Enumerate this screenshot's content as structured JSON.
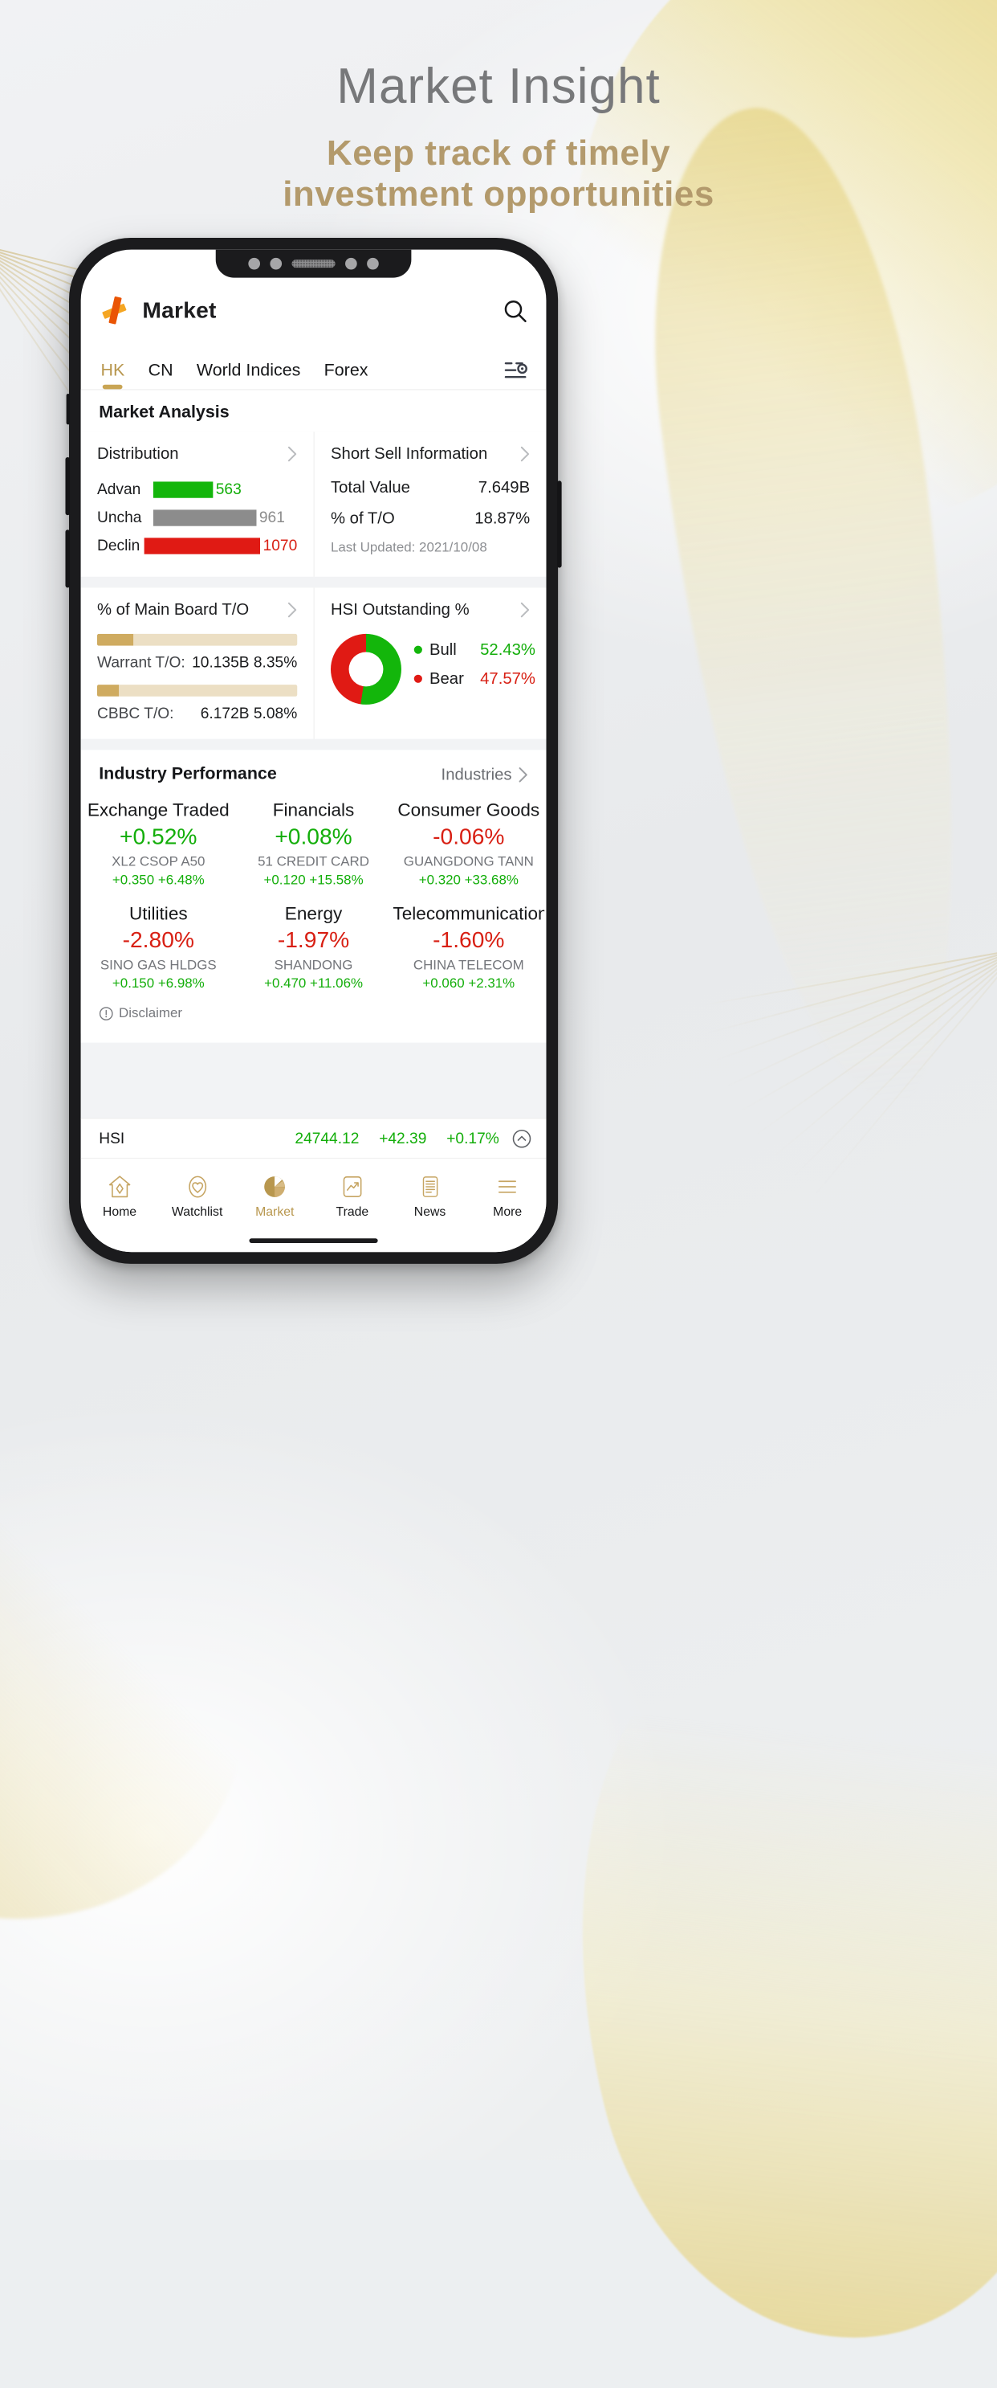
{
  "hero": {
    "title": "Market Insight",
    "subtitle_line1": "Keep track of timely",
    "subtitle_line2": "investment opportunities",
    "title_color": "#77787a",
    "subtitle_color": "#b39a6c"
  },
  "app": {
    "title": "Market",
    "logo_icon": "brand-arrow-logo",
    "search_icon": "search-icon"
  },
  "tabs": {
    "items": [
      {
        "label": "HK",
        "active": true
      },
      {
        "label": "CN",
        "active": false
      },
      {
        "label": "World Indices",
        "active": false
      },
      {
        "label": "Forex",
        "active": false
      }
    ],
    "filter_icon": "settings-sliders-icon",
    "active_color": "#b8974e"
  },
  "market_analysis": {
    "section_title": "Market Analysis",
    "distribution": {
      "title": "Distribution",
      "chevron_icon": "chevron-right-icon",
      "rows": [
        {
          "label": "Advan",
          "value": "563",
          "color": "#13b60b",
          "bar_pct": 33
        },
        {
          "label": "Uncha",
          "value": "961",
          "color": "#8c8c8c",
          "bar_pct": 57
        },
        {
          "label": "Declin",
          "value": "1070",
          "color": "#e01a14",
          "bar_pct": 64
        }
      ]
    },
    "short_sell": {
      "title": "Short Sell Information",
      "chevron_icon": "chevron-right-icon",
      "rows": [
        {
          "label": "Total Value",
          "value": "7.649B"
        },
        {
          "label": "% of T/O",
          "value": "18.87%"
        }
      ],
      "last_updated": "Last Updated: 2021/10/08"
    },
    "main_board": {
      "title": "% of Main Board T/O",
      "chevron_icon": "chevron-right-icon",
      "rows": [
        {
          "label": "Warrant T/O:",
          "value": "10.135B 8.35%",
          "bar_pct": 18
        },
        {
          "label": "CBBC T/O:",
          "value": "6.172B 5.08%",
          "bar_pct": 11
        }
      ]
    },
    "hsi_outstanding": {
      "title": "HSI Outstanding %",
      "chevron_icon": "chevron-right-icon",
      "donut_icon": "donut-chart",
      "legend": [
        {
          "name": "Bull",
          "value": "52.43%",
          "color": "#13b60b"
        },
        {
          "name": "Bear",
          "value": "47.57%",
          "color": "#e01a14"
        }
      ]
    }
  },
  "industry": {
    "section_title": "Industry Performance",
    "more_label": "Industries",
    "more_chevron_icon": "chevron-right-icon",
    "cells": [
      {
        "name": "Exchange Traded",
        "pct": "+0.52%",
        "dir": "up",
        "stock": "XL2 CSOP A50",
        "delta": "+0.350 +6.48%",
        "delta_dir": "up"
      },
      {
        "name": "Financials",
        "pct": "+0.08%",
        "dir": "up",
        "stock": "51 CREDIT CARD",
        "delta": "+0.120 +15.58%",
        "delta_dir": "up"
      },
      {
        "name": "Consumer Goods",
        "pct": "-0.06%",
        "dir": "down",
        "stock": "GUANGDONG TANN",
        "delta": "+0.320 +33.68%",
        "delta_dir": "up"
      },
      {
        "name": "Utilities",
        "pct": "-2.80%",
        "dir": "down",
        "stock": "SINO GAS HLDGS",
        "delta": "+0.150 +6.98%",
        "delta_dir": "up"
      },
      {
        "name": "Energy",
        "pct": "-1.97%",
        "dir": "down",
        "stock": "SHANDONG",
        "delta": "+0.470 +11.06%",
        "delta_dir": "up"
      },
      {
        "name": "Telecommunications",
        "pct": "-1.60%",
        "dir": "down",
        "stock": "CHINA TELECOM",
        "delta": "+0.060 +2.31%",
        "delta_dir": "up"
      }
    ],
    "disclaimer": "Disclaimer",
    "disclaimer_icon": "exclamation-circle-icon"
  },
  "ticker": {
    "symbol": "HSI",
    "price": "24744.12",
    "change": "+42.39",
    "change_pct": "+0.17%",
    "dir": "up",
    "expand_icon": "chevron-up-circle-icon"
  },
  "bottom_nav": {
    "items": [
      {
        "label": "Home",
        "icon": "home-icon",
        "active": false
      },
      {
        "label": "Watchlist",
        "icon": "heart-icon",
        "active": false
      },
      {
        "label": "Market",
        "icon": "pie-chart-icon",
        "active": true
      },
      {
        "label": "Trade",
        "icon": "trend-up-icon",
        "active": false
      },
      {
        "label": "News",
        "icon": "news-icon",
        "active": false
      },
      {
        "label": "More",
        "icon": "menu-icon",
        "active": false
      }
    ],
    "active_color": "#b8974e"
  },
  "colors": {
    "up": "#13ae0a",
    "down": "#d81f13",
    "gold": "#b8974e"
  }
}
